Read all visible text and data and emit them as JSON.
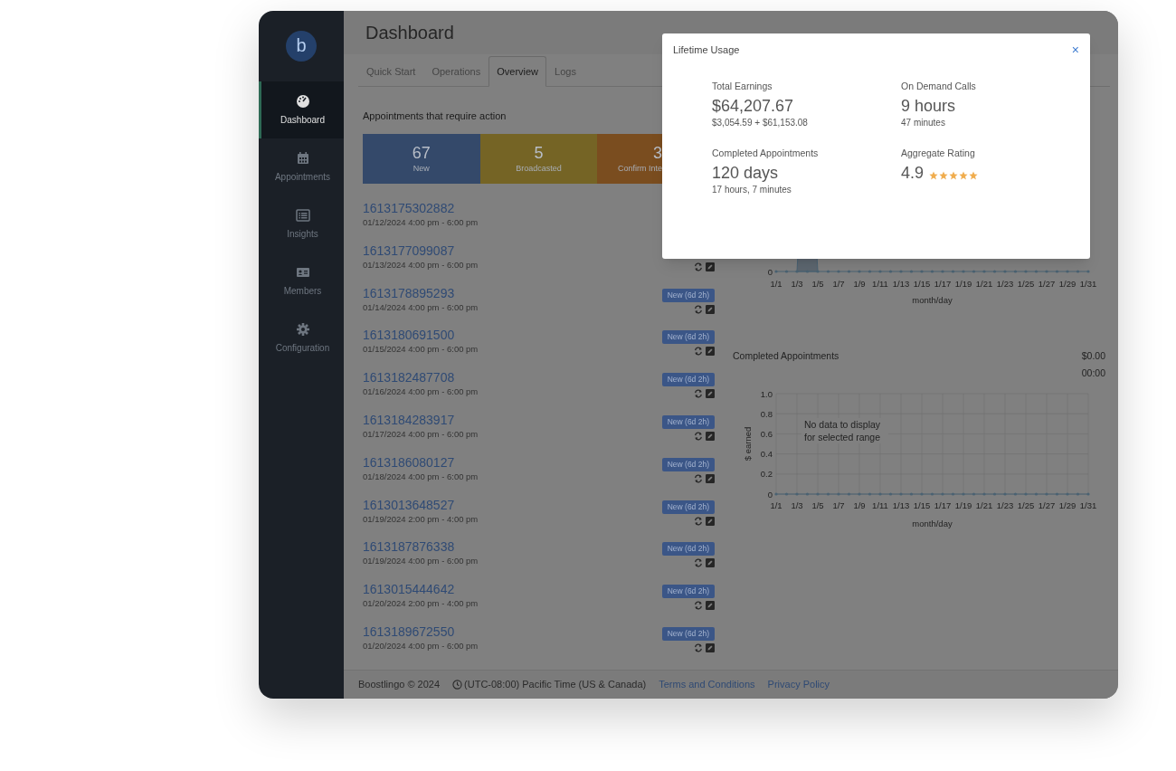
{
  "sidebar": {
    "logo_letter": "b",
    "items": [
      {
        "label": "Dashboard",
        "selected": true
      },
      {
        "label": "Appointments",
        "selected": false
      },
      {
        "label": "Insights",
        "selected": false
      },
      {
        "label": "Members",
        "selected": false
      },
      {
        "label": "Configuration",
        "selected": false
      }
    ]
  },
  "header": {
    "title": "Dashboard"
  },
  "tabs": [
    {
      "label": "Quick Start",
      "selected": false
    },
    {
      "label": "Operations",
      "selected": false
    },
    {
      "label": "Overview",
      "selected": true
    },
    {
      "label": "Logs",
      "selected": false
    }
  ],
  "action_section": {
    "title": "Appointments that require action",
    "tiles": [
      {
        "count": "67",
        "label": "New",
        "color": "#34496a"
      },
      {
        "count": "5",
        "label": "Broadcasted",
        "color": "#756425"
      },
      {
        "count": "3",
        "label": "Confirm Inte",
        "color": "#7a4d1f"
      }
    ]
  },
  "appointments": [
    {
      "id": "1613175302882",
      "time": "01/12/2024 4:00 pm - 6:00 pm",
      "actions": false
    },
    {
      "id": "1613177099087",
      "time": "01/13/2024 4:00 pm - 6:00 pm",
      "actions": true
    },
    {
      "id": "1613178895293",
      "time": "01/14/2024 4:00 pm - 6:00 pm",
      "badge": "New (6d 2h)",
      "actions": true
    },
    {
      "id": "1613180691500",
      "time": "01/15/2024 4:00 pm - 6:00 pm",
      "badge": "New (6d 2h)",
      "actions": true
    },
    {
      "id": "1613182487708",
      "time": "01/16/2024 4:00 pm - 6:00 pm",
      "badge": "New (6d 2h)",
      "actions": true
    },
    {
      "id": "1613184283917",
      "time": "01/17/2024 4:00 pm - 6:00 pm",
      "badge": "New (6d 2h)",
      "actions": true
    },
    {
      "id": "1613186080127",
      "time": "01/18/2024 4:00 pm - 6:00 pm",
      "badge": "New (6d 2h)",
      "actions": true
    },
    {
      "id": "1613013648527",
      "time": "01/19/2024 2:00 pm - 4:00 pm",
      "badge": "New (6d 2h)",
      "actions": true
    },
    {
      "id": "1613187876338",
      "time": "01/19/2024 4:00 pm - 6:00 pm",
      "badge": "New (6d 2h)",
      "actions": true
    },
    {
      "id": "1613015444642",
      "time": "01/20/2024 2:00 pm - 4:00 pm",
      "badge": "New (6d 2h)",
      "actions": true
    },
    {
      "id": "1613189672550",
      "time": "01/20/2024 4:00 pm - 6:00 pm",
      "badge": "New (6d 2h)",
      "actions": true
    }
  ],
  "trend_chart": {
    "y_tick": "0",
    "x_tick_labels": [
      "1/1",
      "1/3",
      "1/5",
      "1/7",
      "1/9",
      "1/11",
      "1/13",
      "1/15",
      "1/17",
      "1/19",
      "1/21",
      "1/23",
      "1/25",
      "1/27",
      "1/29",
      "1/31"
    ],
    "xlabel": "month/day"
  },
  "completed": {
    "title": "Completed Appointments",
    "amount": "$0.00",
    "duration": "00:00",
    "chart_data": {
      "type": "line",
      "xlabel": "month/day",
      "ylabel": "$ earned",
      "categories": [
        "1/1",
        null,
        "1/3",
        null,
        "1/5",
        null,
        "1/7",
        null,
        "1/9",
        null,
        "1/11",
        null,
        "1/13",
        null,
        "1/15",
        null,
        "1/17",
        null,
        "1/19",
        null,
        "1/21",
        null,
        "1/23",
        null,
        "1/25",
        null,
        "1/27",
        null,
        "1/29",
        null,
        "1/31"
      ],
      "series": [
        {
          "color": "#4a6272",
          "values": [
            0,
            0,
            0,
            0,
            0,
            0,
            0,
            0,
            0,
            0,
            0,
            0,
            0,
            0,
            0,
            0,
            0,
            0,
            0,
            0,
            0,
            0,
            0,
            0,
            0,
            0,
            0,
            0,
            0,
            0,
            0
          ]
        }
      ],
      "ylim": [
        0,
        1
      ],
      "grid": true,
      "yticks": [
        {
          "value": 0,
          "label": "0"
        },
        {
          "value": 0.2,
          "label": "0.2"
        },
        {
          "value": 0.4,
          "label": "0.4"
        },
        {
          "value": 0.6,
          "label": "0.6"
        },
        {
          "value": 0.8,
          "label": "0.8"
        },
        {
          "value": 1,
          "label": "1.0"
        }
      ],
      "annotations": [
        "No data to display for selected range"
      ]
    }
  },
  "footer": {
    "copyright": "Boostlingo © 2024",
    "timezone": "(UTC-08:00) Pacific Time (US & Canada)",
    "links": [
      "Terms and Conditions",
      "Privacy Policy"
    ]
  },
  "modal": {
    "title": "Lifetime Usage",
    "close": "×",
    "stats": [
      {
        "kind": "text",
        "label": "Total Earnings",
        "value": "$64,207.67",
        "detail": "$3,054.59 + $61,153.08"
      },
      {
        "kind": "text",
        "label": "On Demand Calls",
        "value": "9 hours",
        "detail": "47 minutes"
      },
      {
        "kind": "text",
        "label": "Completed Appointments",
        "value": "120 days",
        "detail": "17 hours, 7 minutes"
      },
      {
        "kind": "rating",
        "label": "Aggregate Rating",
        "value": "4.9",
        "stars": 5
      }
    ]
  }
}
